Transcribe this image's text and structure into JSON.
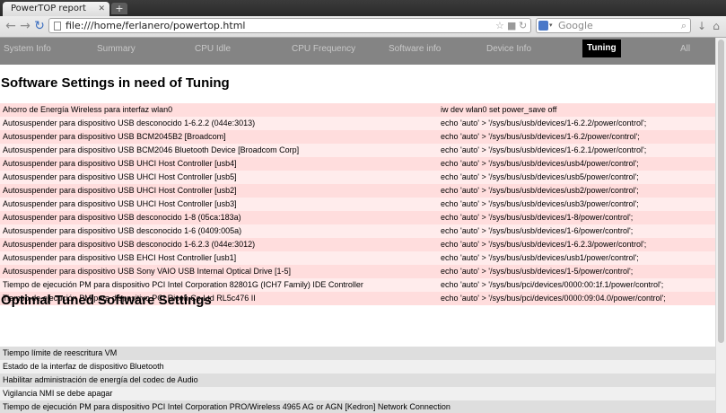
{
  "browser": {
    "tab_title": "PowerTOP report",
    "tab_close": "✕",
    "new_tab": "+",
    "url": "file:///home/ferlanero/powertop.html",
    "search_placeholder": "Google"
  },
  "nav": {
    "items": [
      "System Info",
      "Summary",
      "CPU Idle",
      "CPU Frequency",
      "Software info",
      "Device Info",
      "Tuning",
      "All"
    ],
    "active": "Tuning"
  },
  "tuning_section": {
    "title": "Software Settings in need of Tuning",
    "rows": [
      {
        "desc": "Ahorro de Energía Wireless para interfaz wlan0",
        "cmd": "iw dev wlan0 set power_save off"
      },
      {
        "desc": "Autosuspender para dispositivo USB desconocido 1-6.2.2 (044e:3013)",
        "cmd": "echo 'auto' > '/sys/bus/usb/devices/1-6.2.2/power/control';"
      },
      {
        "desc": "Autosuspender para dispositivo USB BCM2045B2 [Broadcom]",
        "cmd": "echo 'auto' > '/sys/bus/usb/devices/1-6.2/power/control';"
      },
      {
        "desc": "Autosuspender para dispositivo USB BCM2046 Bluetooth Device [Broadcom Corp]",
        "cmd": "echo 'auto' > '/sys/bus/usb/devices/1-6.2.1/power/control';"
      },
      {
        "desc": "Autosuspender para dispositivo USB UHCI Host Controller [usb4]",
        "cmd": "echo 'auto' > '/sys/bus/usb/devices/usb4/power/control';"
      },
      {
        "desc": "Autosuspender para dispositivo USB UHCI Host Controller [usb5]",
        "cmd": "echo 'auto' > '/sys/bus/usb/devices/usb5/power/control';"
      },
      {
        "desc": "Autosuspender para dispositivo USB UHCI Host Controller [usb2]",
        "cmd": "echo 'auto' > '/sys/bus/usb/devices/usb2/power/control';"
      },
      {
        "desc": "Autosuspender para dispositivo USB UHCI Host Controller [usb3]",
        "cmd": "echo 'auto' > '/sys/bus/usb/devices/usb3/power/control';"
      },
      {
        "desc": "Autosuspender para dispositivo USB desconocido 1-8 (05ca:183a)",
        "cmd": "echo 'auto' > '/sys/bus/usb/devices/1-8/power/control';"
      },
      {
        "desc": "Autosuspender para dispositivo USB desconocido 1-6 (0409:005a)",
        "cmd": "echo 'auto' > '/sys/bus/usb/devices/1-6/power/control';"
      },
      {
        "desc": "Autosuspender para dispositivo USB desconocido 1-6.2.3 (044e:3012)",
        "cmd": "echo 'auto' > '/sys/bus/usb/devices/1-6.2.3/power/control';"
      },
      {
        "desc": "Autosuspender para dispositivo USB EHCI Host Controller [usb1]",
        "cmd": "echo 'auto' > '/sys/bus/usb/devices/usb1/power/control';"
      },
      {
        "desc": "Autosuspender para dispositivo USB Sony VAIO USB Internal Optical Drive [1-5]",
        "cmd": "echo 'auto' > '/sys/bus/usb/devices/1-5/power/control';"
      },
      {
        "desc": "Tiempo de ejecución PM para dispositivo PCI Intel Corporation 82801G (ICH7 Family) IDE Controller",
        "cmd": "echo 'auto' > '/sys/bus/pci/devices/0000:00:1f.1/power/control';"
      },
      {
        "desc": "Tiempo de ejecución PM para dispositivo PCI Ricoh Co Ltd RL5c476 II",
        "cmd": "echo 'auto' > '/sys/bus/pci/devices/0000:09:04.0/power/control';"
      }
    ]
  },
  "optimal_section": {
    "title": "Optimal Tuned Software Settings",
    "rows": [
      "Tiempo límite de reescritura VM",
      "Estado de la interfaz de dispositivo Bluetooth",
      "Habilitar administración de energía del codec de Audio",
      "Vigilancia NMI se debe apagar",
      "Tiempo de ejecución PM para dispositivo PCI Intel Corporation PRO/Wireless 4965 AG or AGN [Kedron] Network Connection"
    ]
  },
  "colors": {
    "nav_bg": "#848484",
    "tuning_row_a": "#ffdddd",
    "tuning_row_b": "#ffecec",
    "optimal_row_a": "#dedede",
    "optimal_row_b": "#f0f0f0"
  }
}
